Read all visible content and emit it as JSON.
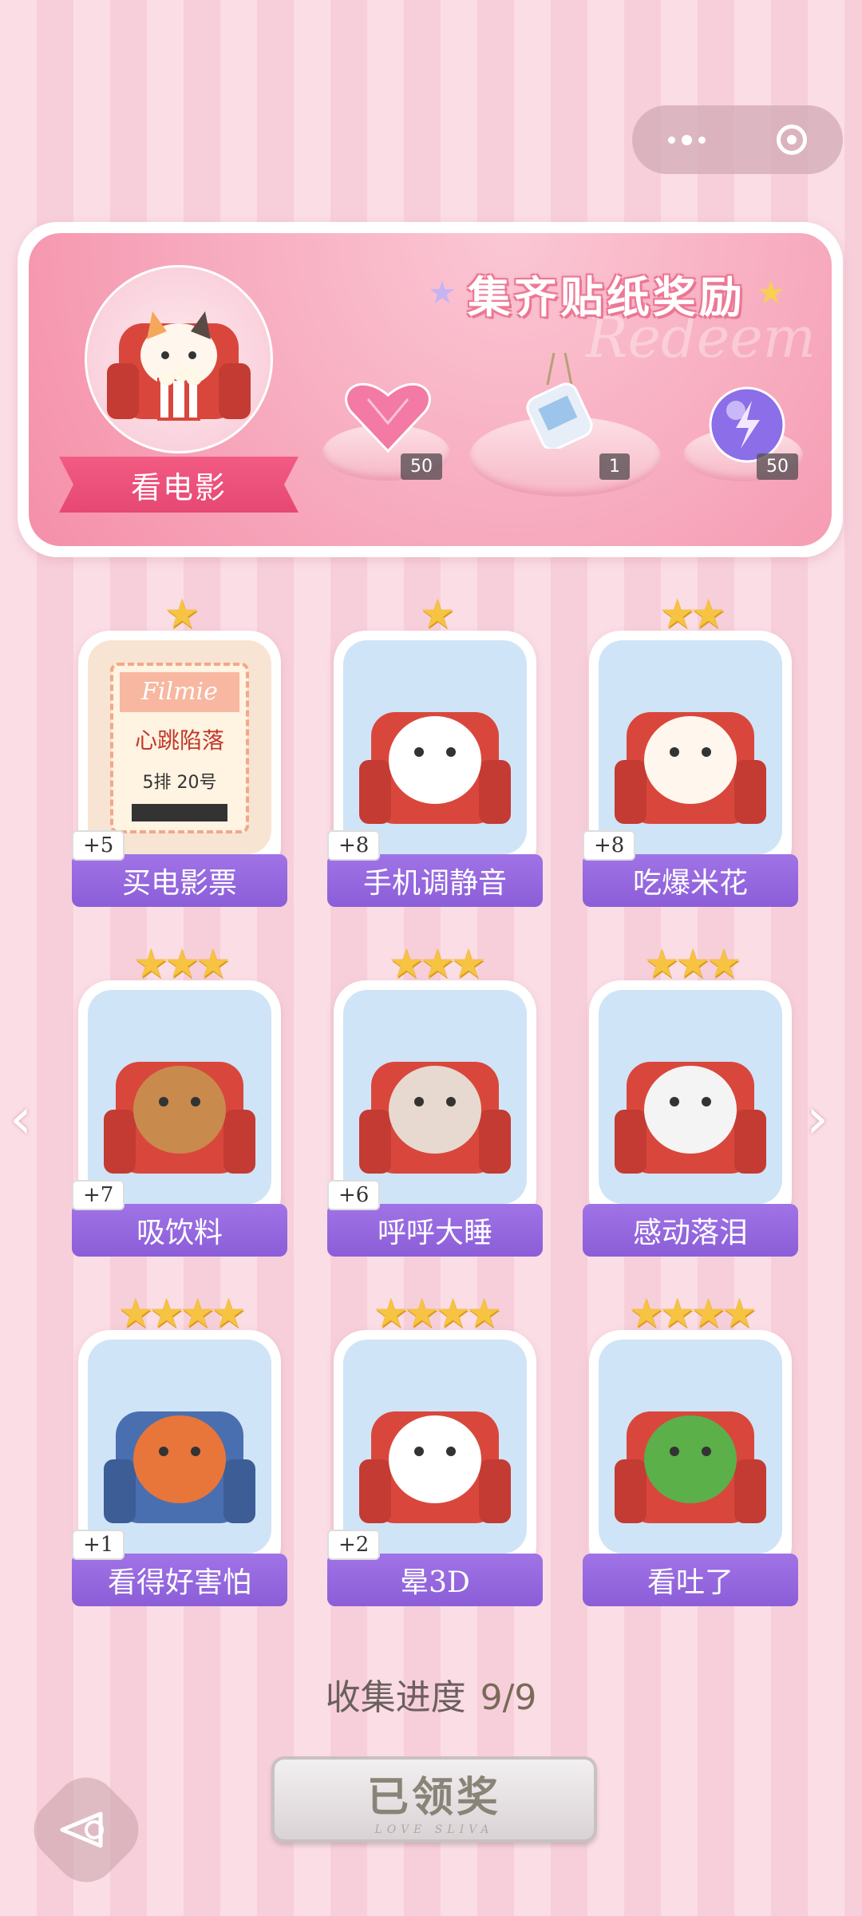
{
  "banner": {
    "title": "集齐贴纸奖励",
    "watermark": "Redeem",
    "movie_label": "看电影",
    "rewards": [
      {
        "name": "pink-heart-gem-icon",
        "count": "50"
      },
      {
        "name": "crystal-bottle-icon",
        "count": "1"
      },
      {
        "name": "purple-lightning-orb-icon",
        "count": "50"
      }
    ]
  },
  "stickers": [
    {
      "label": "买电影票",
      "bonus": "+5",
      "stars": "★",
      "art_text": "Filmie",
      "art_text2": "心跳陷落",
      "art_text3": "5排 20号",
      "icon": "movie-ticket-icon"
    },
    {
      "label": "手机调静音",
      "bonus": "+8",
      "stars": "★",
      "icon": "silent-phone-icon"
    },
    {
      "label": "吃爆米花",
      "bonus": "+8",
      "stars": "★★",
      "icon": "cat-popcorn-icon"
    },
    {
      "label": "吸饮料",
      "bonus": "+7",
      "stars": "★★★",
      "icon": "bear-drink-icon"
    },
    {
      "label": "呼呼大睡",
      "bonus": "+6",
      "stars": "★★★",
      "icon": "hamster-sleep-icon"
    },
    {
      "label": "感动落泪",
      "bonus": "",
      "stars": "★★★",
      "icon": "panda-cry-icon"
    },
    {
      "label": "看得好害怕",
      "bonus": "+1",
      "stars": "★★★★",
      "icon": "scared-fox-icon"
    },
    {
      "label": "晕3D",
      "bonus": "+2",
      "stars": "★★★★",
      "icon": "dizzy-cat-icon"
    },
    {
      "label": "看吐了",
      "bonus": "",
      "stars": "★★★★",
      "icon": "crocodile-rainbow-icon"
    }
  ],
  "progress": {
    "label": "收集进度",
    "value": "9/9"
  },
  "claim_button": {
    "label": "已领奖",
    "sub": "LOVE SLIVA"
  },
  "colors": {
    "accent_pink": "#f25b83",
    "label_purple": "#8b5ed8",
    "card_bg": "#cde3f7"
  }
}
